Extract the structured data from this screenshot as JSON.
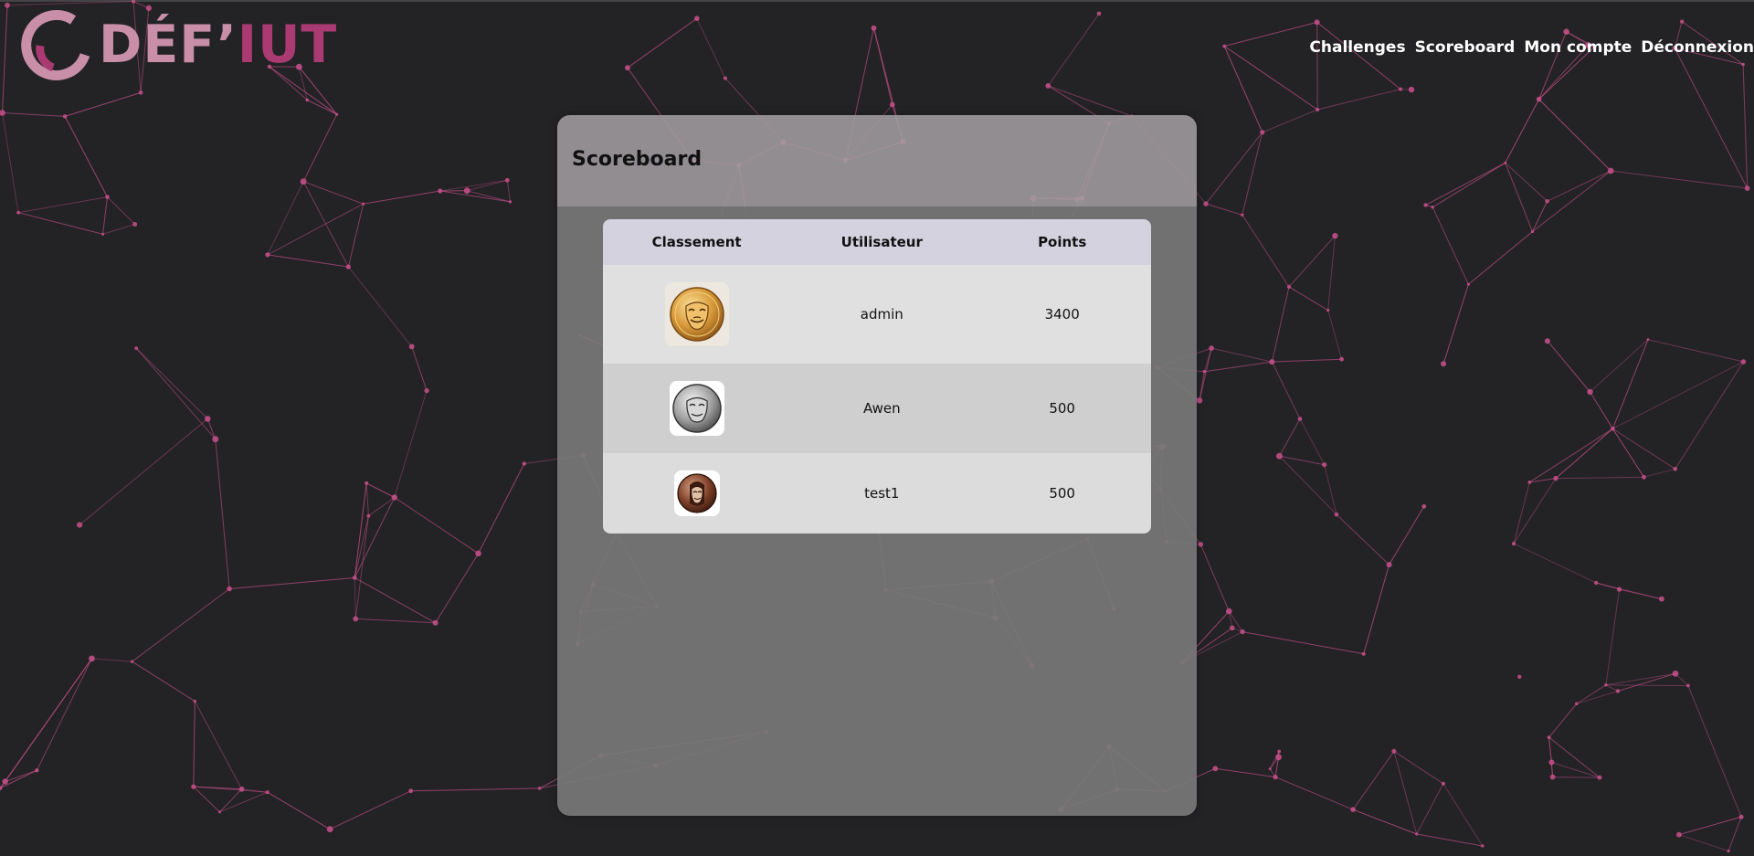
{
  "logo": {
    "text_part1": "DÉF’",
    "text_part2": "IUT",
    "colors": {
      "light": "#c98fa9",
      "dark": "#a93a72"
    }
  },
  "nav": {
    "items": [
      {
        "label": "Challenges"
      },
      {
        "label": "Scoreboard"
      },
      {
        "label": "Mon compte"
      },
      {
        "label": "Déconnexion"
      }
    ]
  },
  "scoreboard": {
    "title": "Scoreboard",
    "columns": [
      "Classement",
      "Utilisateur",
      "Points"
    ],
    "rows": [
      {
        "rank_icon": "gold-medal-icon",
        "user": "admin",
        "points": "3400"
      },
      {
        "rank_icon": "silver-medal-icon",
        "user": "Awen",
        "points": "500"
      },
      {
        "rank_icon": "bronze-medal-icon",
        "user": "test1",
        "points": "500"
      }
    ]
  },
  "theme": {
    "background": "#232325",
    "network_color": "#c8508c",
    "header_row": "#d5d2e0"
  }
}
